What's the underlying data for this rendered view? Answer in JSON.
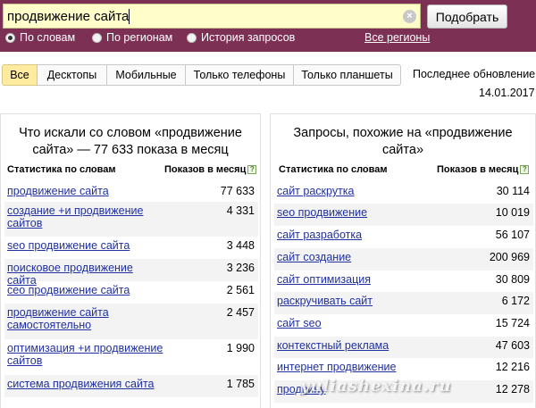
{
  "search": {
    "query": "продвижение сайта",
    "button_label": "Подобрать",
    "clear_icon": "clear-icon"
  },
  "modes": {
    "options": [
      "По словам",
      "По регионам",
      "История запросов"
    ],
    "selected": "По словам",
    "regions_link": "Все регионы"
  },
  "device_tabs": {
    "items": [
      "Все",
      "Десктопы",
      "Мобильные",
      "Только телефоны",
      "Только планшеты"
    ],
    "active": "Все"
  },
  "update": {
    "label": "Последнее обновление:",
    "date": "14.01.2017"
  },
  "left_panel": {
    "title": "Что искали со словом «продвижение сайта» — 77 633 показа в месяц",
    "col_keyword": "Статистика по словам",
    "col_count": "Показов в месяц",
    "rows": [
      {
        "keyword": "продвижение сайта",
        "count": "77 633"
      },
      {
        "keyword": "создание +и продвижение сайтов",
        "count": "4 331"
      },
      {
        "keyword": "seo продвижение сайта",
        "count": "3 448"
      },
      {
        "keyword": "поисковое продвижение сайта",
        "count": "3 236"
      },
      {
        "keyword": "сео продвижение сайта",
        "count": "2 561"
      },
      {
        "keyword": "продвижение сайта самостоятельно",
        "count": "2 457"
      },
      {
        "keyword": "оптимизация +и продвижение сайтов",
        "count": "1 990"
      },
      {
        "keyword": "система продвижения сайта",
        "count": "1 785"
      }
    ]
  },
  "right_panel": {
    "title": "Запросы, похожие на «продвижение сайта»",
    "col_keyword": "Статистика по словам",
    "col_count": "Показов в месяц",
    "rows": [
      {
        "keyword": "сайт раскрутка",
        "count": "30 114"
      },
      {
        "keyword": "seo продвижение",
        "count": "10 019"
      },
      {
        "keyword": "сайт разработка",
        "count": "56 107"
      },
      {
        "keyword": "сайт создание",
        "count": "200 969"
      },
      {
        "keyword": "сайт оптимизация",
        "count": "30 809"
      },
      {
        "keyword": "раскручивать сайт",
        "count": "6 172"
      },
      {
        "keyword": "сайт seo",
        "count": "15 724"
      },
      {
        "keyword": "контекстный реклама",
        "count": "47 603"
      },
      {
        "keyword": "интернет продвижение",
        "count": "12 216"
      },
      {
        "keyword": "продвину",
        "count": "12 278"
      }
    ]
  },
  "watermark": "yuliashexina.ru",
  "colors": {
    "header_bg": "#7b3054",
    "search_bg": "#fffdc9",
    "link": "#2030a0",
    "active_tab": "#ffeba0"
  }
}
